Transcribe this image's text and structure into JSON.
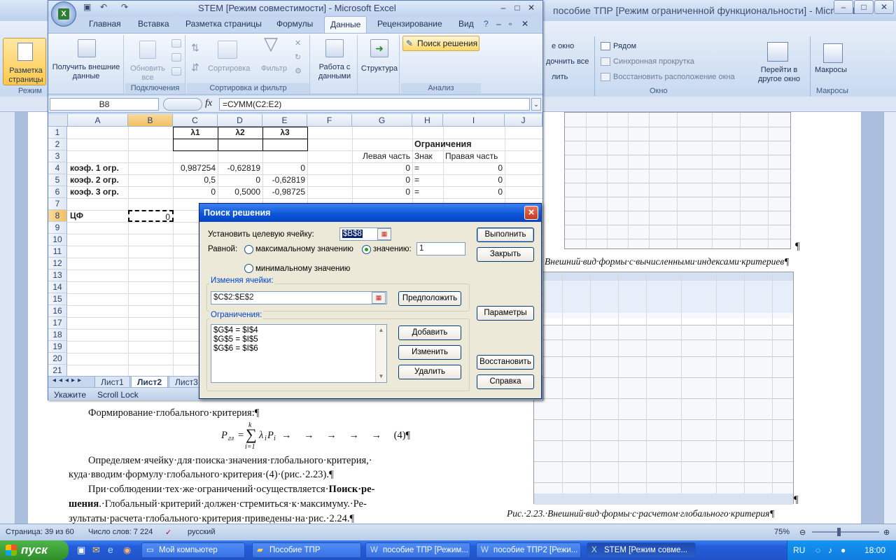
{
  "word": {
    "title": "пособие ТПР [Режим ограниченной функциональности] - Microsoft ...",
    "ribbon": {
      "left_btn": "Разметка страницы",
      "mode_label": "Режим",
      "new_window": "е окно",
      "arrange_all": "дочнить все",
      "split": "лить",
      "side_by_side": "Рядом",
      "sync_scroll": "Синхронная прокрутка",
      "reset_pos": "Восстановить расположение окна",
      "switch_windows": "Перейти в другое окно",
      "macros": "Макросы",
      "group_window": "Окно",
      "group_macros": "Макросы"
    },
    "text": {
      "heading": "Формирование·глобального·критерия:¶",
      "formula_left": "P",
      "formula_sub": "гл",
      "formula_eq": "=",
      "formula_sum_top": "k",
      "formula_sum_bot": "i=1",
      "formula_right": "λ",
      "formula_right_sub": "i",
      "formula_p": "P",
      "formula_p_sub": "i",
      "formula_tabs": "→ → → → → (4)¶",
      "p1_line1": "Определяем·ячейку·для·поиска·значения·глобального·критерия,·",
      "p1_line2": "куда·вводим·формулу·глобального·критерия·(4)·(рис.·2.23).¶",
      "p2_line1a": "При·соблюдении·тех·же·ограничений·осуществляется·",
      "p2_line1b": "Поиск·ре-",
      "p2_line2a": "шения",
      "p2_line2b": ".·Глобальный·критерий·должен·стремиться·к·максимуму.·Ре-",
      "p2_line3": "зультаты·расчета·глобального·критерия·приведены·на·рис.·2.24.¶",
      "caption1": "Внешний·вид·формы·с·вычисленными·индексами·критериев¶",
      "caption2": "Рис.·2.23.·Внешний·вид·формы·с·расчетом·глобального·критерия¶",
      "pilcrow": "¶"
    },
    "status": {
      "page": "Страница: 39 из 60",
      "words": "Число слов: 7 224",
      "lang": "русский",
      "zoom": "75%"
    }
  },
  "excel": {
    "title": "STEM  [Режим совместимости] - Microsoft Excel",
    "tabs": [
      "Главная",
      "Вставка",
      "Разметка страницы",
      "Формулы",
      "Данные",
      "Рецензирование",
      "Вид"
    ],
    "active_tab": "Данные",
    "ribbon": {
      "get_external": "Получить внешние данные",
      "refresh_all": "Обновить все",
      "group_connections": "Подключения",
      "sort": "Сортировка",
      "filter": "Фильтр",
      "group_sort_filter": "Сортировка и фильтр",
      "data_tools": "Работа с данными",
      "outline": "Структура",
      "solver": "Поиск решения",
      "group_analysis": "Анализ"
    },
    "namebox": "B8",
    "fx": "fx",
    "formula": "=СУММ(C2:E2)",
    "columns": [
      "A",
      "B",
      "C",
      "D",
      "E",
      "F",
      "G",
      "H",
      "I",
      "J"
    ],
    "rows": [
      "1",
      "2",
      "3",
      "4",
      "5",
      "6",
      "7",
      "8",
      "9",
      "10",
      "11",
      "12",
      "13",
      "14",
      "15",
      "16",
      "17",
      "18",
      "19",
      "20",
      "21"
    ],
    "cells": {
      "C1": "λ1",
      "D1": "λ2",
      "E1": "λ3",
      "H2": "Ограничения",
      "G3": "Левая часть",
      "H3": "Знак",
      "I3": "Правая часть",
      "A4": "коэф. 1 огр.",
      "C4": "0,987254",
      "D4": "-0,62819",
      "E4": "0",
      "G4": "0",
      "H4": "=",
      "I4": "0",
      "A5": "коэф. 2 огр.",
      "C5": "0,5",
      "D5": "0",
      "E5": "-0,62819",
      "G5": "0",
      "H5": "=",
      "I5": "0",
      "A6": "коэф. 3 огр.",
      "C6": "0",
      "D6": "0,5000",
      "E6": "-0,98725",
      "G6": "0",
      "H6": "=",
      "I6": "0",
      "A8": "ЦФ",
      "B8": "0"
    },
    "sheets": [
      "Лист1",
      "Лист2",
      "Лист3"
    ],
    "active_sheet": "Лист2",
    "status": {
      "mode": "Укажите",
      "scroll_lock": "Scroll Lock"
    }
  },
  "solver": {
    "title": "Поиск решения",
    "target_label": "Установить целевую ячейку:",
    "target_value": "$B$8",
    "equal_label": "Равной:",
    "opt_max": "максимальному значению",
    "opt_value": "значению:",
    "value": "1",
    "opt_min": "минимальному значению",
    "selected_option": "value",
    "changing_label": "Изменяя ячейки:",
    "changing_value": "$C$2:$E$2",
    "constraints_label": "Ограничения:",
    "constraints": [
      "$G$4 = $I$4",
      "$G$5 = $I$5",
      "$G$6 = $I$6"
    ],
    "btn_solve": "Выполнить",
    "btn_close": "Закрыть",
    "btn_guess": "Предположить",
    "btn_options": "Параметры",
    "btn_add": "Добавить",
    "btn_change": "Изменить",
    "btn_delete": "Удалить",
    "btn_reset": "Восстановить",
    "btn_help": "Справка"
  },
  "taskbar": {
    "start": "пуск",
    "items": [
      "Мой компьютер",
      "Пособие ТПР",
      "пособие ТПР [Режим...",
      "пособие ТПР2 [Режи...",
      "STEM  [Режим совме..."
    ],
    "active_item": "STEM  [Режим совме...",
    "lang": "RU",
    "clock": "18:00"
  },
  "colors": {
    "accent": "#0b54d6",
    "ribbon": "#c5d7ef",
    "taskbar": "#245edb",
    "start": "#3c9d36"
  }
}
